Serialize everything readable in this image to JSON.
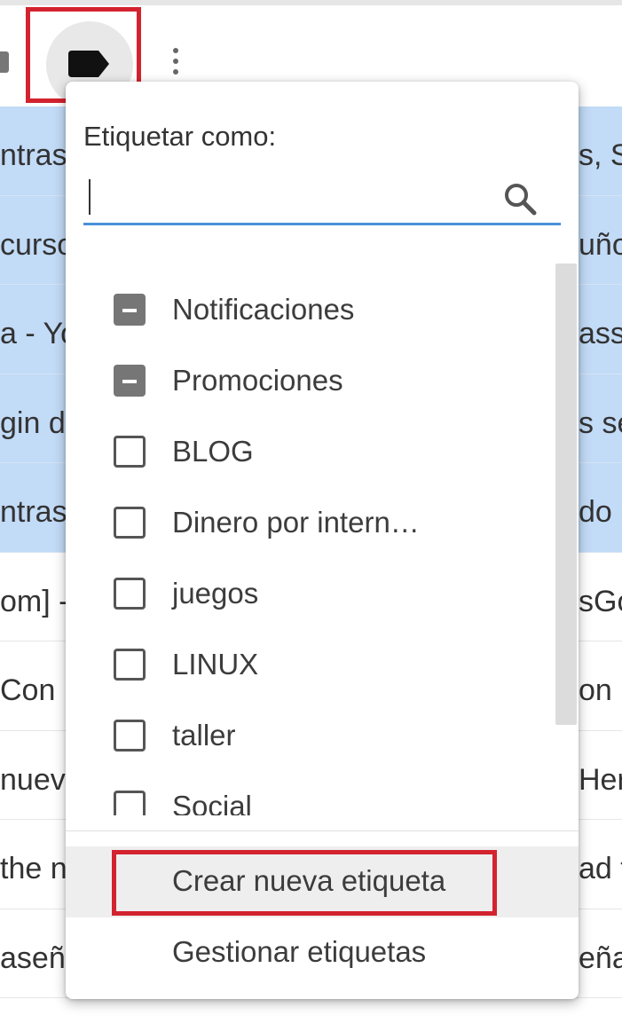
{
  "email_rows": [
    {
      "left": "ntras",
      "right": "s, S",
      "selected": true
    },
    {
      "left": "curso",
      "right": "uño",
      "selected": true
    },
    {
      "left": "a - Yo",
      "right": "ass",
      "selected": true
    },
    {
      "left": "gin de",
      "right": "s se",
      "selected": true
    },
    {
      "left": "ntras",
      "right": "do",
      "selected": true
    },
    {
      "left": "om] -",
      "right": "sGo",
      "selected": false
    },
    {
      "left": " Con",
      "right": "on",
      "selected": false
    },
    {
      "left": "nueva",
      "right": "Her",
      "selected": false
    },
    {
      "left": "the n",
      "right": "ad t",
      "selected": false
    },
    {
      "left": "aseña",
      "right": "eña",
      "selected": false
    }
  ],
  "label_menu": {
    "title": "Etiquetar como:",
    "search_value": "",
    "labels": [
      {
        "text": "Notificaciones",
        "state": "partial"
      },
      {
        "text": "Promociones",
        "state": "partial"
      },
      {
        "text": "BLOG",
        "state": "unchecked"
      },
      {
        "text": "Dinero por intern…",
        "state": "unchecked"
      },
      {
        "text": "juegos",
        "state": "unchecked"
      },
      {
        "text": "LINUX",
        "state": "unchecked"
      },
      {
        "text": "taller",
        "state": "unchecked"
      },
      {
        "text": "Social",
        "state": "unchecked"
      }
    ],
    "create_label": "Crear nueva etiqueta",
    "manage_label": "Gestionar etiquetas"
  },
  "icons": {
    "label": "label-icon",
    "more": "more-vert-icon",
    "search": "search-icon"
  },
  "colors": {
    "highlight": "#d3232f",
    "selected_row": "#c2dbf7",
    "focus_line": "#4a90d9"
  }
}
